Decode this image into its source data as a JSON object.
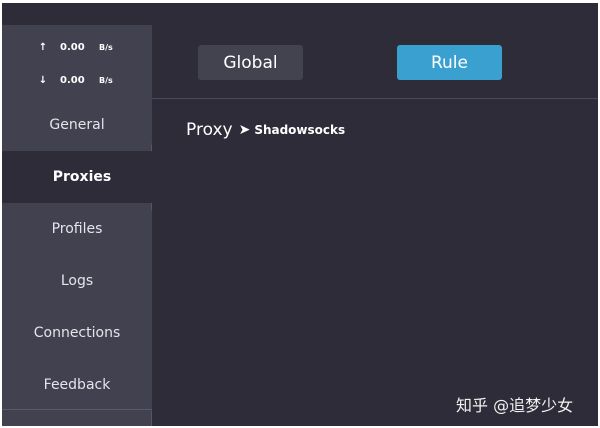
{
  "traffic": {
    "upload": {
      "arrow": "↑",
      "rate": "0.00",
      "unit": "B/s"
    },
    "download": {
      "arrow": "↓",
      "rate": "0.00",
      "unit": "B/s"
    }
  },
  "sidebar": {
    "items": [
      {
        "label": "General",
        "active": false
      },
      {
        "label": "Proxies",
        "active": true
      },
      {
        "label": "Profiles",
        "active": false
      },
      {
        "label": "Logs",
        "active": false
      },
      {
        "label": "Connections",
        "active": false
      },
      {
        "label": "Feedback",
        "active": false
      }
    ]
  },
  "header": {
    "mode_global": "Global",
    "mode_rule": "Rule",
    "selected_mode": "Rule"
  },
  "breadcrumb": {
    "root": "Proxy",
    "separator": "➤",
    "leaf": "Shadowsocks"
  },
  "watermark": "知乎 @追梦少女",
  "colors": {
    "background": "#2d2c38",
    "sidebar": "#42414f",
    "button": "#43424f",
    "accent": "#3aa0cf"
  }
}
